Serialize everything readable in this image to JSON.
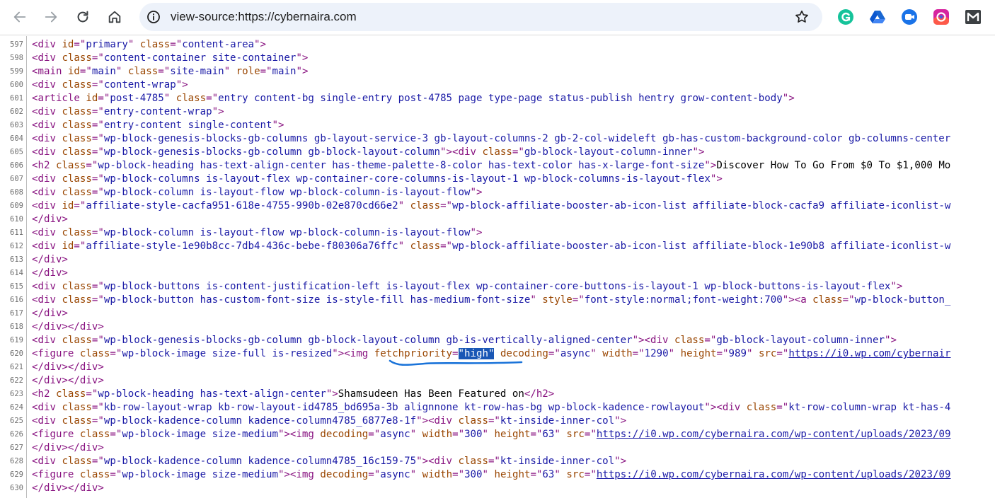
{
  "browser": {
    "url": "view-source:https://cybernaira.com",
    "extensions": [
      "grammarly-icon",
      "google-drive-icon",
      "screencast-icon",
      "colorful-circle-icon",
      "gmail-m-icon"
    ]
  },
  "source": {
    "lines": [
      {
        "n": "597",
        "tokens": [
          [
            "tag",
            "<div "
          ],
          [
            "an",
            "id"
          ],
          [
            "tag",
            "=\""
          ],
          [
            "av",
            "primary"
          ],
          [
            "tag",
            "\" "
          ],
          [
            "an",
            "class"
          ],
          [
            "tag",
            "=\""
          ],
          [
            "av",
            "content-area"
          ],
          [
            "tag",
            "\">"
          ]
        ]
      },
      {
        "n": "598",
        "tokens": [
          [
            "tag",
            "<div "
          ],
          [
            "an",
            "class"
          ],
          [
            "tag",
            "=\""
          ],
          [
            "av",
            "content-container site-container"
          ],
          [
            "tag",
            "\">"
          ]
        ]
      },
      {
        "n": "599",
        "tokens": [
          [
            "tag",
            "<main "
          ],
          [
            "an",
            "id"
          ],
          [
            "tag",
            "=\""
          ],
          [
            "av",
            "main"
          ],
          [
            "tag",
            "\" "
          ],
          [
            "an",
            "class"
          ],
          [
            "tag",
            "=\""
          ],
          [
            "av",
            "site-main"
          ],
          [
            "tag",
            "\" "
          ],
          [
            "an",
            "role"
          ],
          [
            "tag",
            "=\""
          ],
          [
            "av",
            "main"
          ],
          [
            "tag",
            "\">"
          ]
        ]
      },
      {
        "n": "600",
        "tokens": [
          [
            "tag",
            "<div "
          ],
          [
            "an",
            "class"
          ],
          [
            "tag",
            "=\""
          ],
          [
            "av",
            "content-wrap"
          ],
          [
            "tag",
            "\">"
          ]
        ]
      },
      {
        "n": "601",
        "tokens": [
          [
            "tag",
            "<article "
          ],
          [
            "an",
            "id"
          ],
          [
            "tag",
            "=\""
          ],
          [
            "av",
            "post-4785"
          ],
          [
            "tag",
            "\" "
          ],
          [
            "an",
            "class"
          ],
          [
            "tag",
            "=\""
          ],
          [
            "av",
            "entry content-bg single-entry post-4785 page type-page status-publish hentry grow-content-body"
          ],
          [
            "tag",
            "\">"
          ]
        ]
      },
      {
        "n": "602",
        "tokens": [
          [
            "tag",
            "<div "
          ],
          [
            "an",
            "class"
          ],
          [
            "tag",
            "=\""
          ],
          [
            "av",
            "entry-content-wrap"
          ],
          [
            "tag",
            "\">"
          ]
        ]
      },
      {
        "n": "603",
        "tokens": [
          [
            "tag",
            "<div "
          ],
          [
            "an",
            "class"
          ],
          [
            "tag",
            "=\""
          ],
          [
            "av",
            "entry-content single-content"
          ],
          [
            "tag",
            "\">"
          ]
        ]
      },
      {
        "n": "604",
        "tokens": [
          [
            "tag",
            "<div "
          ],
          [
            "an",
            "class"
          ],
          [
            "tag",
            "=\""
          ],
          [
            "av",
            "wp-block-genesis-blocks-gb-columns gb-layout-service-3 gb-layout-columns-2 gb-2-col-wideleft gb-has-custom-background-color gb-columns-center"
          ]
        ]
      },
      {
        "n": "605",
        "tokens": [
          [
            "tag",
            "<div "
          ],
          [
            "an",
            "class"
          ],
          [
            "tag",
            "=\""
          ],
          [
            "av",
            "wp-block-genesis-blocks-gb-column gb-block-layout-column"
          ],
          [
            "tag",
            "\"><div "
          ],
          [
            "an",
            "class"
          ],
          [
            "tag",
            "=\""
          ],
          [
            "av",
            "gb-block-layout-column-inner"
          ],
          [
            "tag",
            "\">"
          ]
        ]
      },
      {
        "n": "606",
        "tokens": [
          [
            "tag",
            "<h2 "
          ],
          [
            "an",
            "class"
          ],
          [
            "tag",
            "=\""
          ],
          [
            "av",
            "wp-block-heading has-text-align-center has-theme-palette-8-color has-text-color has-x-large-font-size"
          ],
          [
            "tag",
            "\">"
          ],
          [
            "tx",
            "Discover How To Go From $0 To $1,000 Mo"
          ]
        ]
      },
      {
        "n": "607",
        "tokens": [
          [
            "tag",
            "<div "
          ],
          [
            "an",
            "class"
          ],
          [
            "tag",
            "=\""
          ],
          [
            "av",
            "wp-block-columns is-layout-flex wp-container-core-columns-is-layout-1 wp-block-columns-is-layout-flex"
          ],
          [
            "tag",
            "\">"
          ]
        ]
      },
      {
        "n": "608",
        "tokens": [
          [
            "tag",
            "<div "
          ],
          [
            "an",
            "class"
          ],
          [
            "tag",
            "=\""
          ],
          [
            "av",
            "wp-block-column is-layout-flow wp-block-column-is-layout-flow"
          ],
          [
            "tag",
            "\">"
          ]
        ]
      },
      {
        "n": "609",
        "tokens": [
          [
            "tag",
            "<div "
          ],
          [
            "an",
            "id"
          ],
          [
            "tag",
            "=\""
          ],
          [
            "av",
            "affiliate-style-cacfa951-618e-4755-990b-02e870cd66e2"
          ],
          [
            "tag",
            "\" "
          ],
          [
            "an",
            "class"
          ],
          [
            "tag",
            "=\""
          ],
          [
            "av",
            "wp-block-affiliate-booster-ab-icon-list affiliate-block-cacfa9 affiliate-iconlist-w"
          ]
        ]
      },
      {
        "n": "610",
        "tokens": [
          [
            "tag",
            "</div>"
          ]
        ]
      },
      {
        "n": "611",
        "tokens": [
          [
            "tag",
            "<div "
          ],
          [
            "an",
            "class"
          ],
          [
            "tag",
            "=\""
          ],
          [
            "av",
            "wp-block-column is-layout-flow wp-block-column-is-layout-flow"
          ],
          [
            "tag",
            "\">"
          ]
        ]
      },
      {
        "n": "612",
        "tokens": [
          [
            "tag",
            "<div "
          ],
          [
            "an",
            "id"
          ],
          [
            "tag",
            "=\""
          ],
          [
            "av",
            "affiliate-style-1e90b8cc-7db4-436c-bebe-f80306a76ffc"
          ],
          [
            "tag",
            "\" "
          ],
          [
            "an",
            "class"
          ],
          [
            "tag",
            "=\""
          ],
          [
            "av",
            "wp-block-affiliate-booster-ab-icon-list affiliate-block-1e90b8 affiliate-iconlist-w"
          ]
        ]
      },
      {
        "n": "613",
        "tokens": [
          [
            "tag",
            "</div>"
          ]
        ]
      },
      {
        "n": "614",
        "tokens": [
          [
            "tag",
            "</div>"
          ]
        ]
      },
      {
        "n": "615",
        "tokens": [
          [
            "tag",
            "<div "
          ],
          [
            "an",
            "class"
          ],
          [
            "tag",
            "=\""
          ],
          [
            "av",
            "wp-block-buttons is-content-justification-left is-layout-flex wp-container-core-buttons-is-layout-1 wp-block-buttons-is-layout-flex"
          ],
          [
            "tag",
            "\">"
          ]
        ]
      },
      {
        "n": "616",
        "tokens": [
          [
            "tag",
            "<div "
          ],
          [
            "an",
            "class"
          ],
          [
            "tag",
            "=\""
          ],
          [
            "av",
            "wp-block-button has-custom-font-size is-style-fill has-medium-font-size"
          ],
          [
            "tag",
            "\" "
          ],
          [
            "an",
            "style"
          ],
          [
            "tag",
            "=\""
          ],
          [
            "av",
            "font-style:normal;font-weight:700"
          ],
          [
            "tag",
            "\"><a "
          ],
          [
            "an",
            "class"
          ],
          [
            "tag",
            "=\""
          ],
          [
            "av",
            "wp-block-button_"
          ]
        ]
      },
      {
        "n": "617",
        "tokens": [
          [
            "tag",
            "</div>"
          ]
        ]
      },
      {
        "n": "618",
        "tokens": [
          [
            "tag",
            "</div></div>"
          ]
        ]
      },
      {
        "n": "619",
        "tokens": [
          [
            "tag",
            "<div "
          ],
          [
            "an",
            "class"
          ],
          [
            "tag",
            "=\""
          ],
          [
            "av",
            "wp-block-genesis-blocks-gb-column gb-block-layout-column gb-is-vertically-aligned-center"
          ],
          [
            "tag",
            "\"><div "
          ],
          [
            "an",
            "class"
          ],
          [
            "tag",
            "=\""
          ],
          [
            "av",
            "gb-block-layout-column-inner"
          ],
          [
            "tag",
            "\">"
          ]
        ]
      },
      {
        "n": "620",
        "tokens": [
          [
            "tag",
            "<figure "
          ],
          [
            "an",
            "class"
          ],
          [
            "tag",
            "=\""
          ],
          [
            "av",
            "wp-block-image size-full is-resized"
          ],
          [
            "tag",
            "\"><img "
          ],
          [
            "an",
            "fetchpriority"
          ],
          [
            "tag",
            "="
          ],
          [
            "sel",
            "\"high\""
          ],
          [
            "tag",
            " "
          ],
          [
            "an",
            "decoding"
          ],
          [
            "tag",
            "=\""
          ],
          [
            "av",
            "async"
          ],
          [
            "tag",
            "\" "
          ],
          [
            "an",
            "width"
          ],
          [
            "tag",
            "=\""
          ],
          [
            "av",
            "1290"
          ],
          [
            "tag",
            "\" "
          ],
          [
            "an",
            "height"
          ],
          [
            "tag",
            "=\""
          ],
          [
            "av",
            "989"
          ],
          [
            "tag",
            "\" "
          ],
          [
            "an",
            "src"
          ],
          [
            "tag",
            "=\""
          ],
          [
            "lk",
            "https://i0.wp.com/cybernair"
          ]
        ]
      },
      {
        "n": "621",
        "tokens": [
          [
            "tag",
            "</div></div>"
          ]
        ]
      },
      {
        "n": "622",
        "tokens": [
          [
            "tag",
            "</div></div>"
          ]
        ]
      },
      {
        "n": "623",
        "tokens": [
          [
            "tag",
            "<h2 "
          ],
          [
            "an",
            "class"
          ],
          [
            "tag",
            "=\""
          ],
          [
            "av",
            "wp-block-heading has-text-align-center"
          ],
          [
            "tag",
            "\">"
          ],
          [
            "tx",
            "Shamsudeen Has Been Featured on"
          ],
          [
            "tag",
            "</h2>"
          ]
        ]
      },
      {
        "n": "624",
        "tokens": [
          [
            "tag",
            "<div "
          ],
          [
            "an",
            "class"
          ],
          [
            "tag",
            "=\""
          ],
          [
            "av",
            "kb-row-layout-wrap kb-row-layout-id4785_bd695a-3b alignnone kt-row-has-bg wp-block-kadence-rowlayout"
          ],
          [
            "tag",
            "\"><div "
          ],
          [
            "an",
            "class"
          ],
          [
            "tag",
            "=\""
          ],
          [
            "av",
            "kt-row-column-wrap kt-has-4"
          ]
        ]
      },
      {
        "n": "625",
        "tokens": [
          [
            "tag",
            "<div "
          ],
          [
            "an",
            "class"
          ],
          [
            "tag",
            "=\""
          ],
          [
            "av",
            "wp-block-kadence-column kadence-column4785_6877e8-1f"
          ],
          [
            "tag",
            "\"><div "
          ],
          [
            "an",
            "class"
          ],
          [
            "tag",
            "=\""
          ],
          [
            "av",
            "kt-inside-inner-col"
          ],
          [
            "tag",
            "\">"
          ]
        ]
      },
      {
        "n": "626",
        "tokens": [
          [
            "tag",
            "<figure "
          ],
          [
            "an",
            "class"
          ],
          [
            "tag",
            "=\""
          ],
          [
            "av",
            "wp-block-image size-medium"
          ],
          [
            "tag",
            "\"><img "
          ],
          [
            "an",
            "decoding"
          ],
          [
            "tag",
            "=\""
          ],
          [
            "av",
            "async"
          ],
          [
            "tag",
            "\" "
          ],
          [
            "an",
            "width"
          ],
          [
            "tag",
            "=\""
          ],
          [
            "av",
            "300"
          ],
          [
            "tag",
            "\" "
          ],
          [
            "an",
            "height"
          ],
          [
            "tag",
            "=\""
          ],
          [
            "av",
            "63"
          ],
          [
            "tag",
            "\" "
          ],
          [
            "an",
            "src"
          ],
          [
            "tag",
            "=\""
          ],
          [
            "lk",
            "https://i0.wp.com/cybernaira.com/wp-content/uploads/2023/09"
          ]
        ]
      },
      {
        "n": "627",
        "tokens": [
          [
            "tag",
            "</div></div>"
          ]
        ]
      },
      {
        "n": "628",
        "tokens": [
          [
            "tag",
            "<div "
          ],
          [
            "an",
            "class"
          ],
          [
            "tag",
            "=\""
          ],
          [
            "av",
            "wp-block-kadence-column kadence-column4785_16c159-75"
          ],
          [
            "tag",
            "\"><div "
          ],
          [
            "an",
            "class"
          ],
          [
            "tag",
            "=\""
          ],
          [
            "av",
            "kt-inside-inner-col"
          ],
          [
            "tag",
            "\">"
          ]
        ]
      },
      {
        "n": "629",
        "tokens": [
          [
            "tag",
            "<figure "
          ],
          [
            "an",
            "class"
          ],
          [
            "tag",
            "=\""
          ],
          [
            "av",
            "wp-block-image size-medium"
          ],
          [
            "tag",
            "\"><img "
          ],
          [
            "an",
            "decoding"
          ],
          [
            "tag",
            "=\""
          ],
          [
            "av",
            "async"
          ],
          [
            "tag",
            "\" "
          ],
          [
            "an",
            "width"
          ],
          [
            "tag",
            "=\""
          ],
          [
            "av",
            "300"
          ],
          [
            "tag",
            "\" "
          ],
          [
            "an",
            "height"
          ],
          [
            "tag",
            "=\""
          ],
          [
            "av",
            "63"
          ],
          [
            "tag",
            "\" "
          ],
          [
            "an",
            "src"
          ],
          [
            "tag",
            "=\""
          ],
          [
            "lk",
            "https://i0.wp.com/cybernaira.com/wp-content/uploads/2023/09"
          ]
        ]
      },
      {
        "n": "630",
        "tokens": [
          [
            "tag",
            "</div></div>"
          ]
        ]
      }
    ]
  },
  "colors": {
    "tag": "#881280",
    "attr_name": "#994500",
    "attr_value": "#1a1aa6",
    "selection": "#1a57b5",
    "annotation": "#1a73d9"
  }
}
